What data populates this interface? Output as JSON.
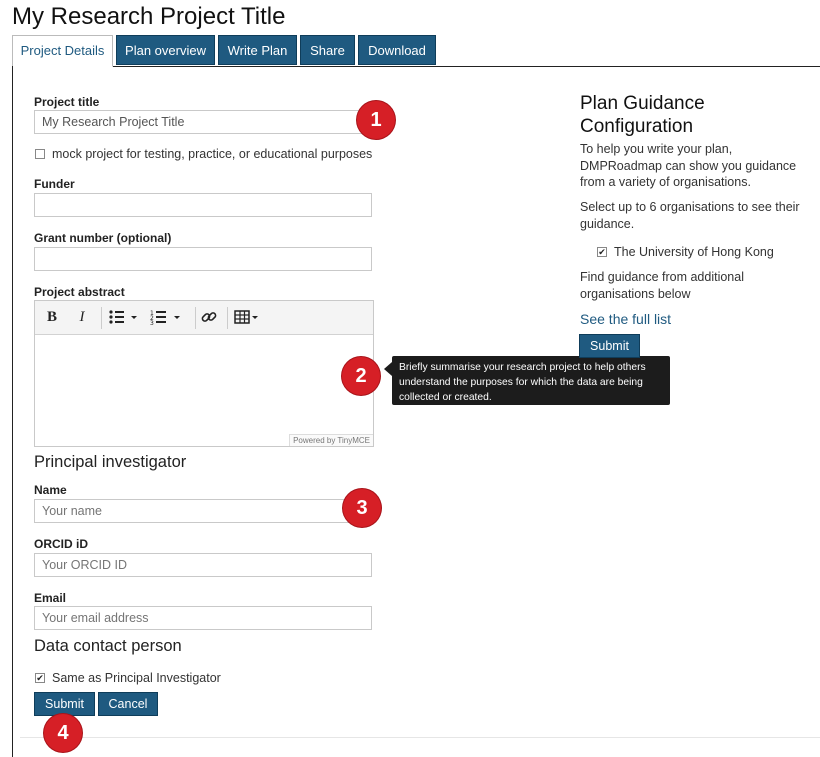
{
  "page_title": "My Research Project Title",
  "tabs": [
    {
      "label": "Project Details",
      "active": true
    },
    {
      "label": "Plan overview",
      "active": false
    },
    {
      "label": "Write Plan",
      "active": false
    },
    {
      "label": "Share",
      "active": false
    },
    {
      "label": "Download",
      "active": false
    }
  ],
  "form": {
    "project_title_label": "Project title",
    "project_title_value": "My Research Project Title",
    "mock_label": "mock project for testing, practice, or educational purposes",
    "mock_checked": false,
    "funder_label": "Funder",
    "funder_value": "",
    "grant_label": "Grant number (optional)",
    "grant_value": "",
    "abstract_label": "Project abstract",
    "editor_powered": "Powered by TinyMCE",
    "pi_heading": "Principal investigator",
    "name_label": "Name",
    "name_placeholder": "Your name",
    "orcid_label": "ORCID iD",
    "orcid_placeholder": "Your ORCID ID",
    "email_label": "Email",
    "email_placeholder": "Your email address",
    "contact_heading": "Data contact person",
    "same_as_label": "Same as Principal Investigator",
    "same_as_checked": true,
    "submit_label": "Submit",
    "cancel_label": "Cancel"
  },
  "tooltip": {
    "text": "Briefly summarise your research project to help others understand the purposes for which the data are being collected or created."
  },
  "badges": [
    "1",
    "2",
    "3",
    "4"
  ],
  "guidance": {
    "heading": "Plan Guidance Configuration",
    "intro": "To help you write your plan, DMPRoadmap can show you guidance from a variety of organisations.",
    "select_text": "Select up to 6 organisations to see their guidance.",
    "org_label": "The University of Hong Kong",
    "org_checked": true,
    "find_text": "Find guidance from additional organisations below",
    "link_label": "See the full list",
    "submit_label": "Submit"
  },
  "toolbar_icons": [
    "bold-icon",
    "italic-icon",
    "bullet-list-icon",
    "numbered-list-icon",
    "link-icon",
    "table-icon"
  ],
  "colors": {
    "accent": "#1f5a80",
    "badge": "#d61f26",
    "tooltip_bg": "#1c1c1c"
  }
}
